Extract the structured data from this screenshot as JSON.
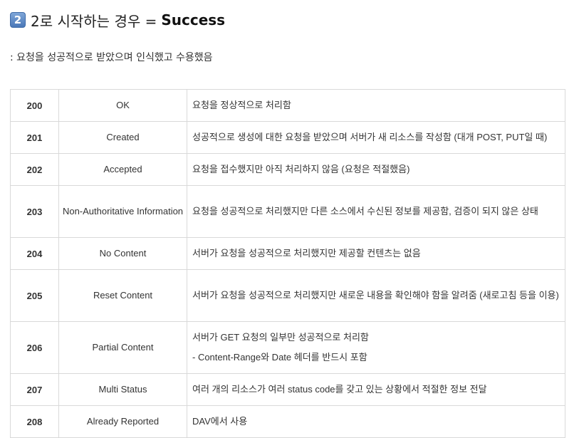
{
  "heading": {
    "badge": "2",
    "prefix": "2로 시작하는 경우 =",
    "strong": "Success"
  },
  "subtitle": ": 요청을 성공적으로 받았으며 인식했고 수용했음",
  "rows": [
    {
      "code": "200",
      "name": "OK",
      "desc": "요청을 정상적으로 처리함"
    },
    {
      "code": "201",
      "name": "Created",
      "desc": "성공적으로 생성에 대한 요청을 받았으며 서버가 새 리소스를 작성함 (대개 POST, PUT일 때)"
    },
    {
      "code": "202",
      "name": "Accepted",
      "desc": "요청을 접수했지만 아직 처리하지 않음 (요청은 적절했음)"
    },
    {
      "code": "203",
      "name": "Non-Authoritative Information",
      "desc": "요청을 성공적으로 처리했지만 다른 소스에서 수신된 정보를 제공함, 검증이 되지 않은 상태"
    },
    {
      "code": "204",
      "name": "No Content",
      "desc": "서버가 요청을 성공적으로 처리했지만 제공할 컨텐츠는 없음"
    },
    {
      "code": "205",
      "name": "Reset Content",
      "desc": "서버가 요청을 성공적으로 처리했지만 새로운 내용을 확인해야 함을 알려줌 (새로고침 등을 이용)"
    },
    {
      "code": "206",
      "name": "Partial Content",
      "desc": "서버가 GET 요청의 일부만 성공적으로 처리함",
      "desc2": "- Content-Range와 Date 헤더를 반드시 포함"
    },
    {
      "code": "207",
      "name": "Multi Status",
      "desc": "여러 개의 리소스가 여러 status code를 갖고 있는 상황에서 적절한 정보 전달"
    },
    {
      "code": "208",
      "name": "Already Reported",
      "desc": "DAV에서 사용"
    }
  ]
}
